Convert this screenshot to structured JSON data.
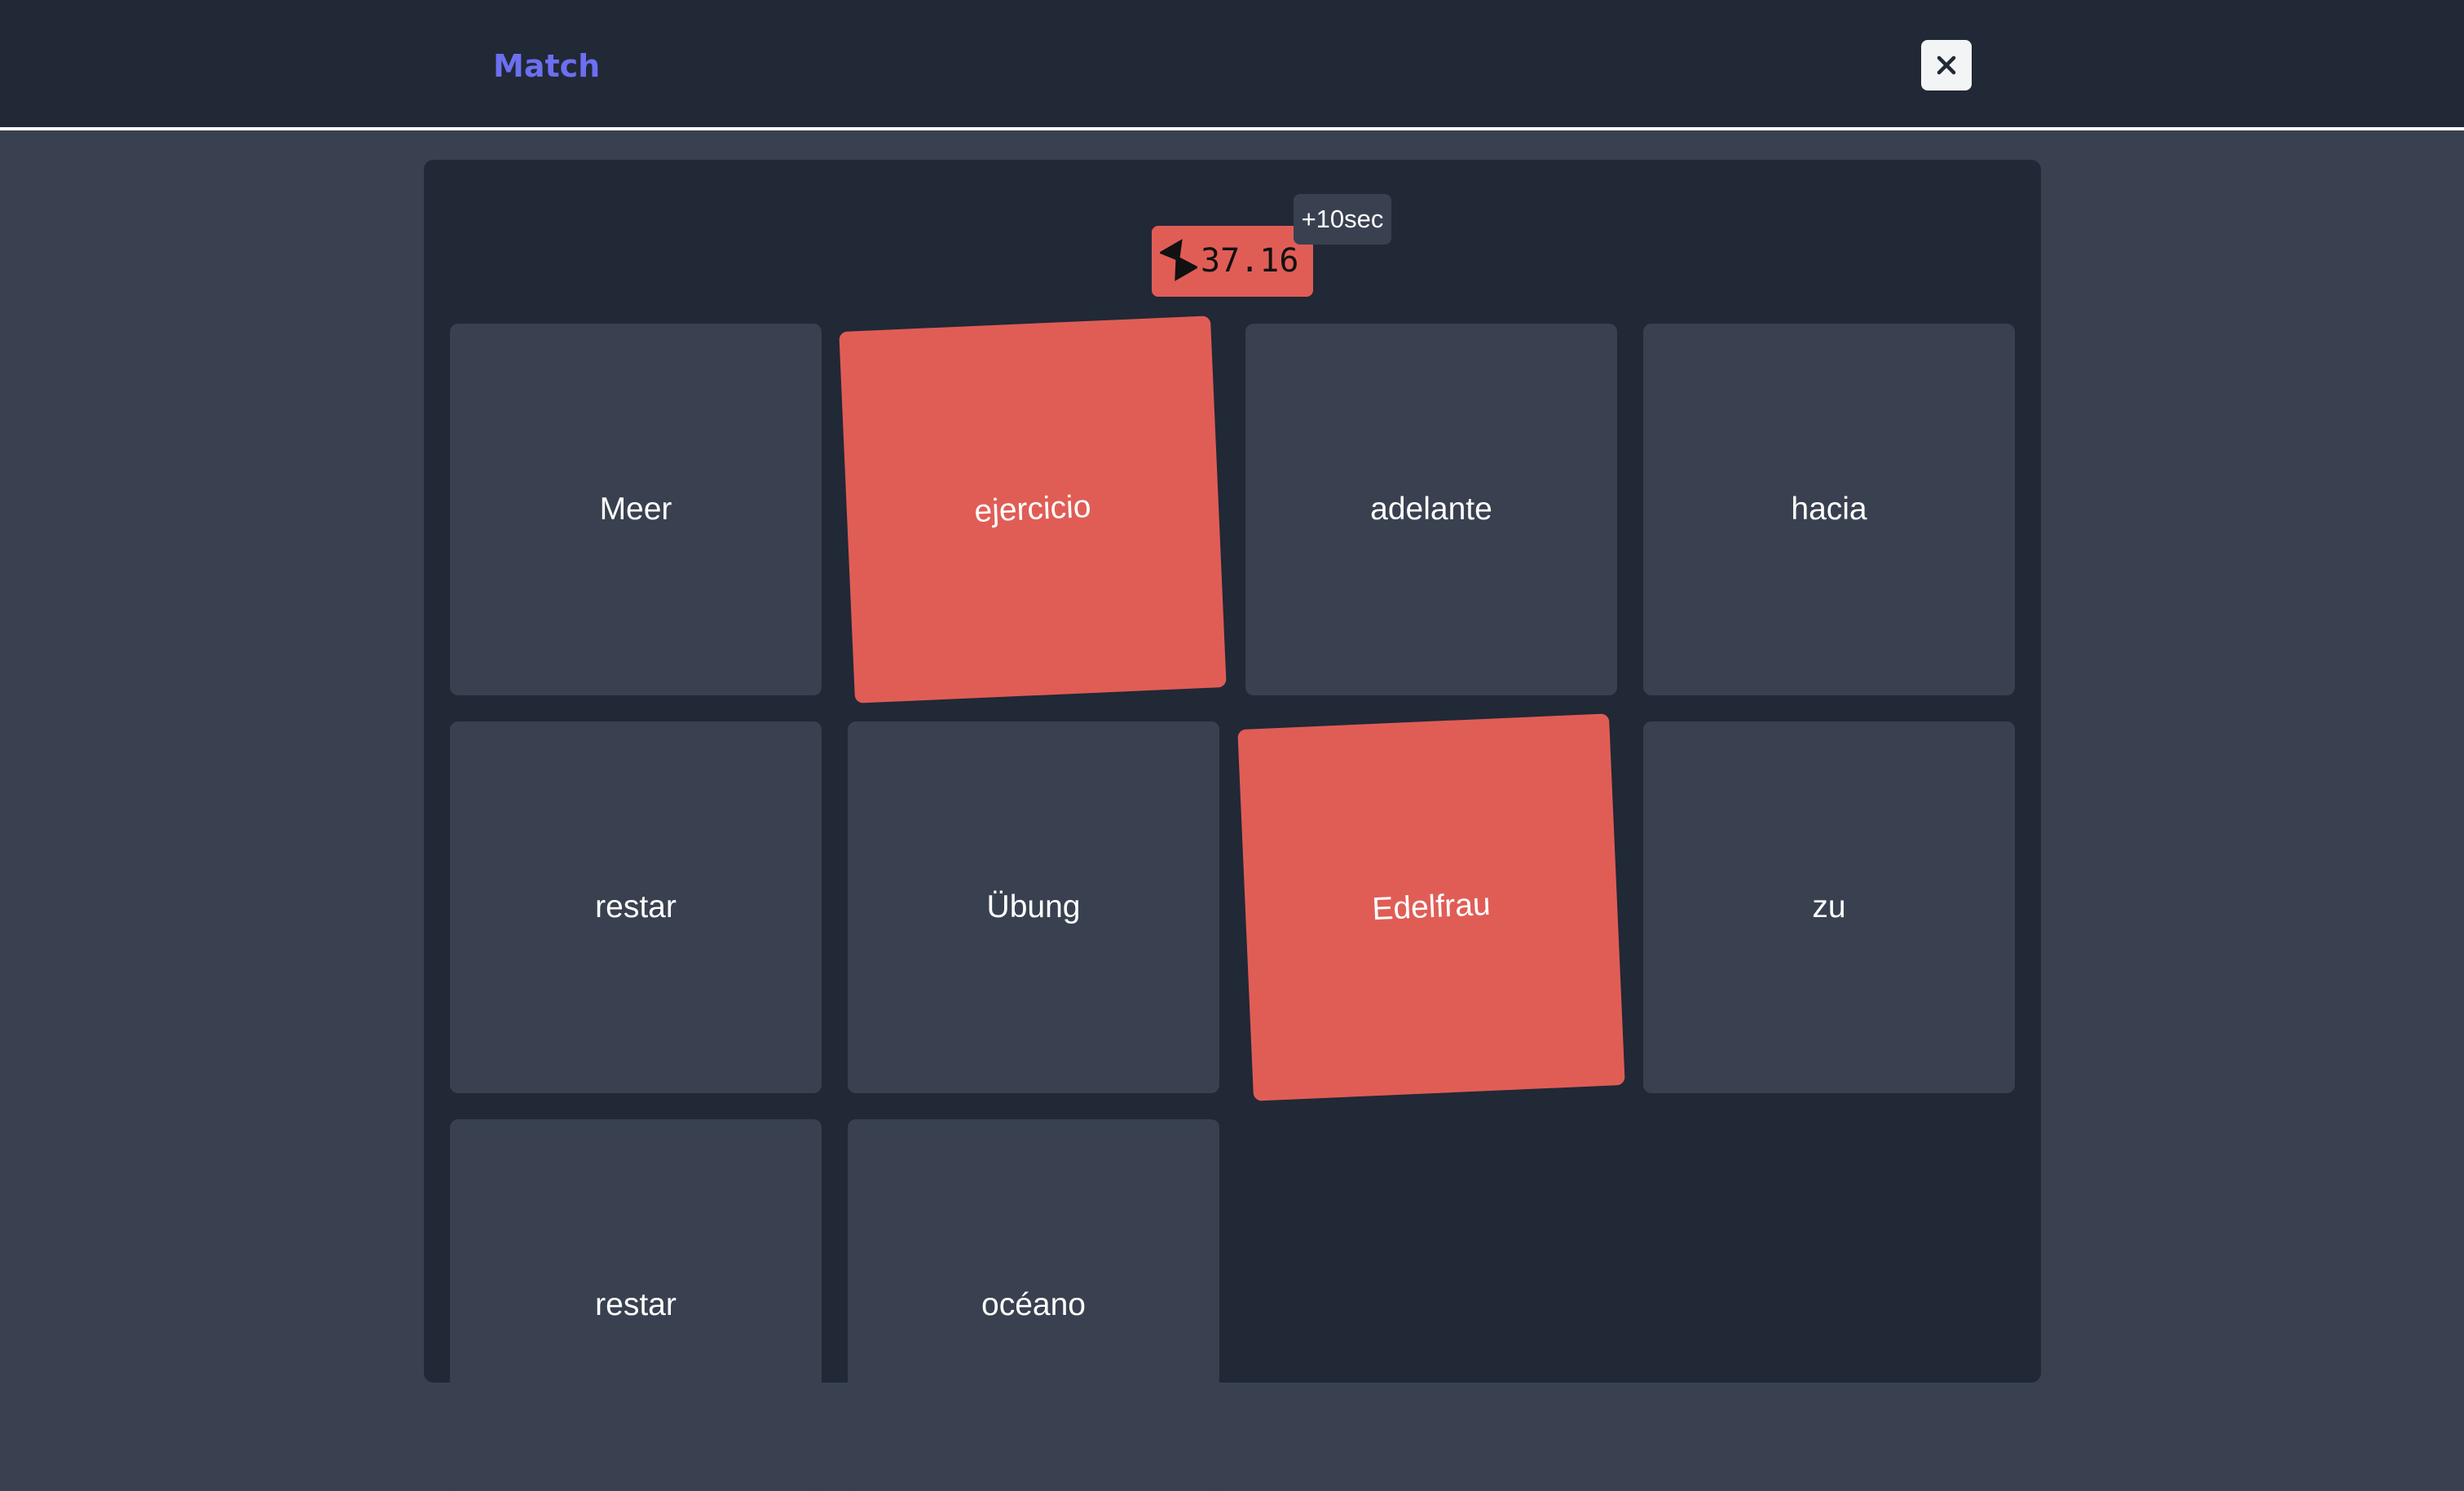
{
  "header": {
    "title": "Match",
    "close_icon": "close-icon"
  },
  "game": {
    "timer": "37.16",
    "timer_icon": "hourglass-icon",
    "penalty": "+10sec",
    "colors": {
      "accent": "#6c6ff0",
      "tile": "#394150",
      "tile_selected": "#e05d56",
      "panel": "#212836"
    },
    "tiles": [
      {
        "label": "Meer",
        "selected": false
      },
      {
        "label": "ejercicio",
        "selected": true
      },
      {
        "label": "adelante",
        "selected": false
      },
      {
        "label": "hacia",
        "selected": false
      },
      {
        "label": "restar",
        "selected": false
      },
      {
        "label": "Übung",
        "selected": false
      },
      {
        "label": "Edelfrau",
        "selected": true
      },
      {
        "label": "zu",
        "selected": false
      },
      {
        "label": "restar",
        "selected": false
      },
      {
        "label": "océano",
        "selected": false
      }
    ]
  }
}
